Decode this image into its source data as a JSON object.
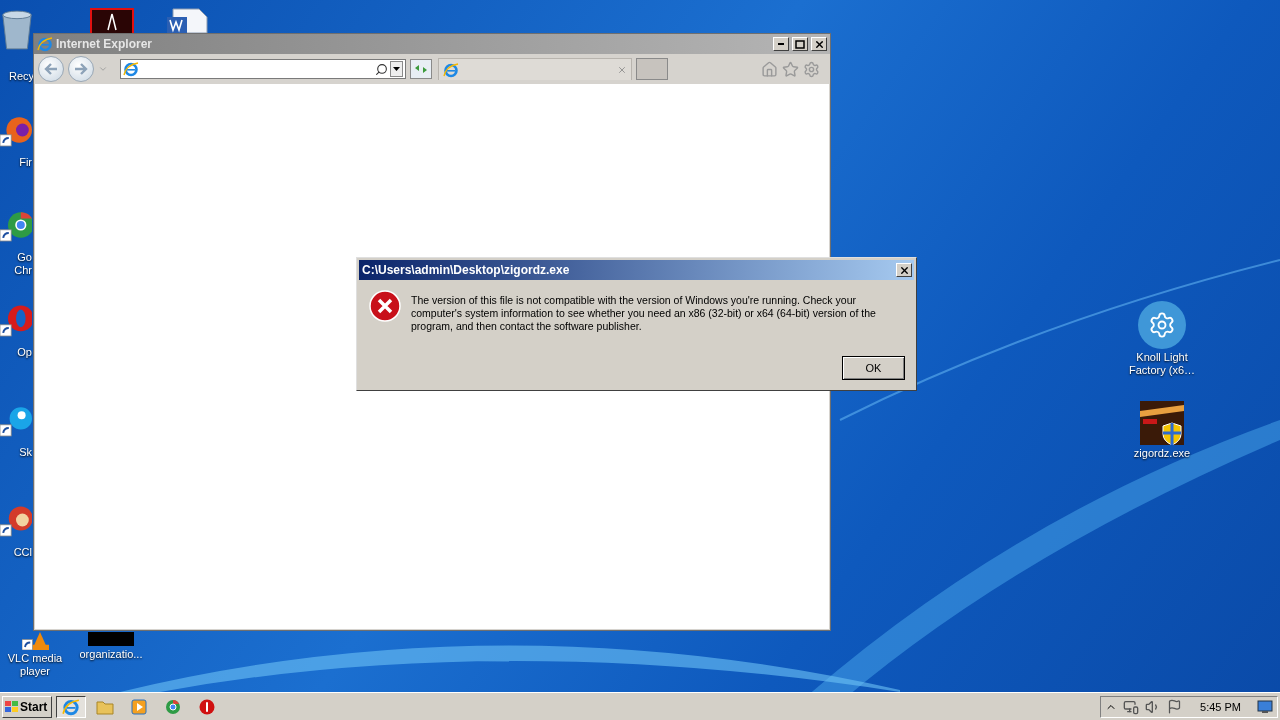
{
  "desktop_icons": [
    {
      "kind": "recycle",
      "label": "Recy"
    },
    {
      "kind": "pdf"
    },
    {
      "kind": "word"
    },
    {
      "kind": "firefox",
      "label": "Fir"
    },
    {
      "kind": "chrome",
      "label": "Go Chr"
    },
    {
      "kind": "opera",
      "label": "Op"
    },
    {
      "kind": "skype",
      "label": "Sk"
    },
    {
      "kind": "ccleaner",
      "label": "CCl"
    },
    {
      "kind": "vlc",
      "label": "VLC media player"
    },
    {
      "kind": "blackfile",
      "label": "organizatio..."
    },
    {
      "kind": "gear",
      "label": "Knoll Light Factory (x6…"
    },
    {
      "kind": "shieldapp",
      "label": "zigordz.exe"
    }
  ],
  "ie_window": {
    "title": "Internet Explorer"
  },
  "dialog": {
    "title": "C:\\Users\\admin\\Desktop\\zigordz.exe",
    "message": "The version of this file is not compatible with the version of Windows you're running. Check your computer's system information to see whether you need an x86 (32-bit) or x64 (64-bit) version of the program, and then contact the software publisher.",
    "buttons": [
      "OK"
    ]
  },
  "taskbar": {
    "start": "Start",
    "apps": [
      {
        "kind": "ie"
      },
      {
        "kind": "folder"
      },
      {
        "kind": "media"
      },
      {
        "kind": "chrome"
      },
      {
        "kind": "stop"
      }
    ],
    "clock": "5:45 PM"
  }
}
